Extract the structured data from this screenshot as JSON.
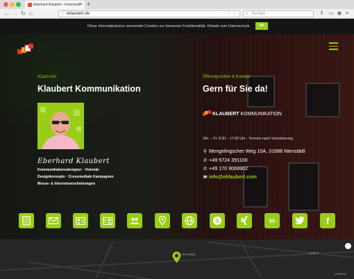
{
  "browser": {
    "tab_title": "Eberhard Klaubert - Kommunik",
    "tab_close": "×",
    "new_tab": "+",
    "url": "eklaubert.de",
    "search_placeholder": "Suchen"
  },
  "cookie_banner": {
    "text": "Diese Internetpräsenz verwendet Cookies zur besseren Funktionalität. Details zum Datenschutz.",
    "ok_label": "OK"
  },
  "vcard": {
    "label": "vCard von",
    "heading": "Klaubert Kommunikation",
    "name": "Eberhard Klaubert",
    "roles": [
      "Kommunikationsdesigner · Visionär",
      "Designkonzepte · Crossmediale Kampagnen",
      "Messe- & Internetserscheinungen"
    ]
  },
  "contact": {
    "label": "Öffnungszeiten & Kontakt",
    "heading": "Gern für Sie da!",
    "brand_bold": "KLAUBERT",
    "brand_regular": "KOMMUNIKATION",
    "hours": "Mo. – Fr. 8:30 – 17:00 Uhr · Termine nach Vereinbarung",
    "address": "Mengelingscher Weg 10A, 31688 Nienstädt",
    "phone": "+49 5724 391100",
    "mobile": "+49 170 9069902",
    "email": "info@eklaubert.com"
  },
  "socials": [
    {
      "name": "vcard-doc",
      "text": ""
    },
    {
      "name": "mail",
      "text": ""
    },
    {
      "name": "contact-card",
      "text": ""
    },
    {
      "name": "address-card",
      "text": ""
    },
    {
      "name": "team",
      "text": ""
    },
    {
      "name": "location",
      "text": ""
    },
    {
      "name": "website",
      "text": ""
    },
    {
      "name": "skype",
      "text": ""
    },
    {
      "name": "xing",
      "text": ""
    },
    {
      "name": "linkedin",
      "text": "in"
    },
    {
      "name": "twitter",
      "text": ""
    },
    {
      "name": "facebook",
      "text": "f"
    }
  ],
  "map": {
    "label_center": "Nienstädt",
    "label_right": "Apelern",
    "label_corner": "Lauenau"
  },
  "colors": {
    "accent": "#9acd17",
    "banner_bg": "#141414"
  }
}
